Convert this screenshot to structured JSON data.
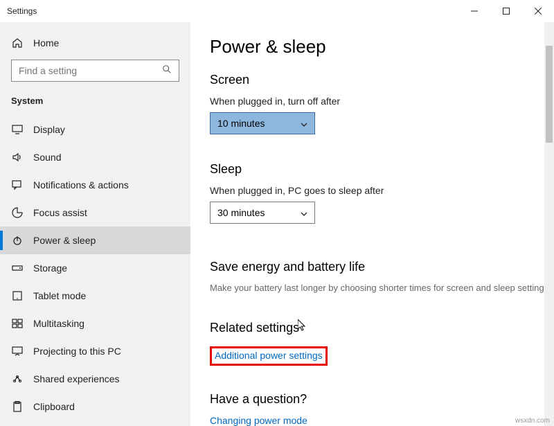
{
  "window": {
    "title": "Settings"
  },
  "sidebar": {
    "home": "Home",
    "search_placeholder": "Find a setting",
    "section": "System",
    "items": [
      {
        "label": "Display"
      },
      {
        "label": "Sound"
      },
      {
        "label": "Notifications & actions"
      },
      {
        "label": "Focus assist"
      },
      {
        "label": "Power & sleep"
      },
      {
        "label": "Storage"
      },
      {
        "label": "Tablet mode"
      },
      {
        "label": "Multitasking"
      },
      {
        "label": "Projecting to this PC"
      },
      {
        "label": "Shared experiences"
      },
      {
        "label": "Clipboard"
      }
    ]
  },
  "main": {
    "title": "Power & sleep",
    "screen": {
      "heading": "Screen",
      "label": "When plugged in, turn off after",
      "value": "10 minutes"
    },
    "sleep": {
      "heading": "Sleep",
      "label": "When plugged in, PC goes to sleep after",
      "value": "30 minutes"
    },
    "energy": {
      "heading": "Save energy and battery life",
      "desc": "Make your battery last longer by choosing shorter times for screen and sleep settings."
    },
    "related": {
      "heading": "Related settings",
      "link": "Additional power settings"
    },
    "question": {
      "heading": "Have a question?",
      "link": "Changing power mode"
    }
  },
  "watermark": "wsxdn.com"
}
